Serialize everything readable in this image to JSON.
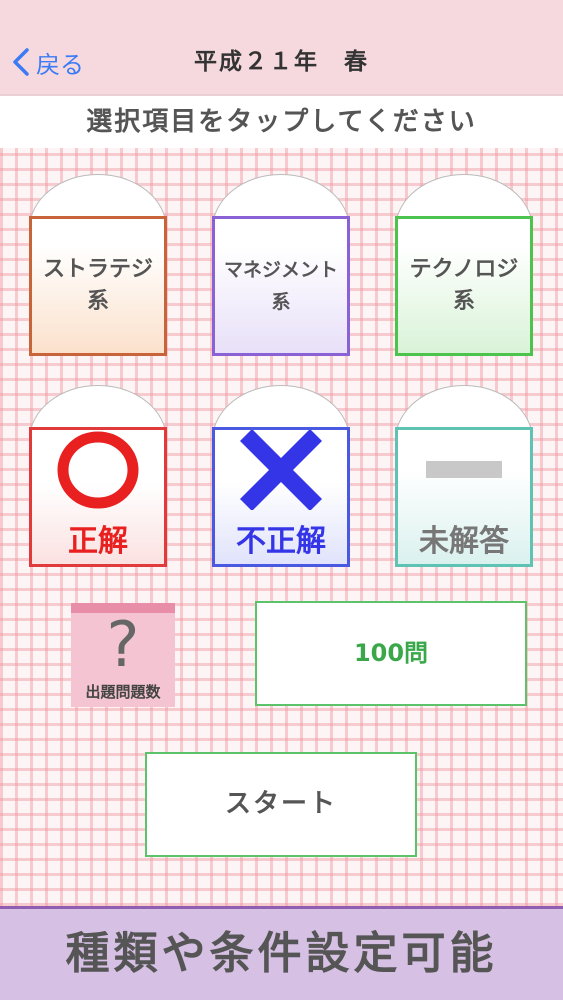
{
  "navbar": {
    "back_label": "戻る",
    "title": "平成２１年　春"
  },
  "instruction": "選択項目をタップしてください",
  "categories": [
    {
      "label": "ストラテジ\n系",
      "color": "#c8643a"
    },
    {
      "label": "マネジメント\n系",
      "color": "#8a62d6"
    },
    {
      "label": "テクノロジ\n系",
      "color": "#4cc34c"
    }
  ],
  "results": {
    "correct": {
      "label": "正解",
      "color": "#e82020"
    },
    "incorrect": {
      "label": "不正解",
      "color": "#3535e8"
    },
    "unanswered": {
      "label": "未解答",
      "color": "#777777"
    }
  },
  "question_count": {
    "icon": "?",
    "label": "出題問題数",
    "value": "100問"
  },
  "start_label": "スタート",
  "banner": "種類や条件設定可能"
}
